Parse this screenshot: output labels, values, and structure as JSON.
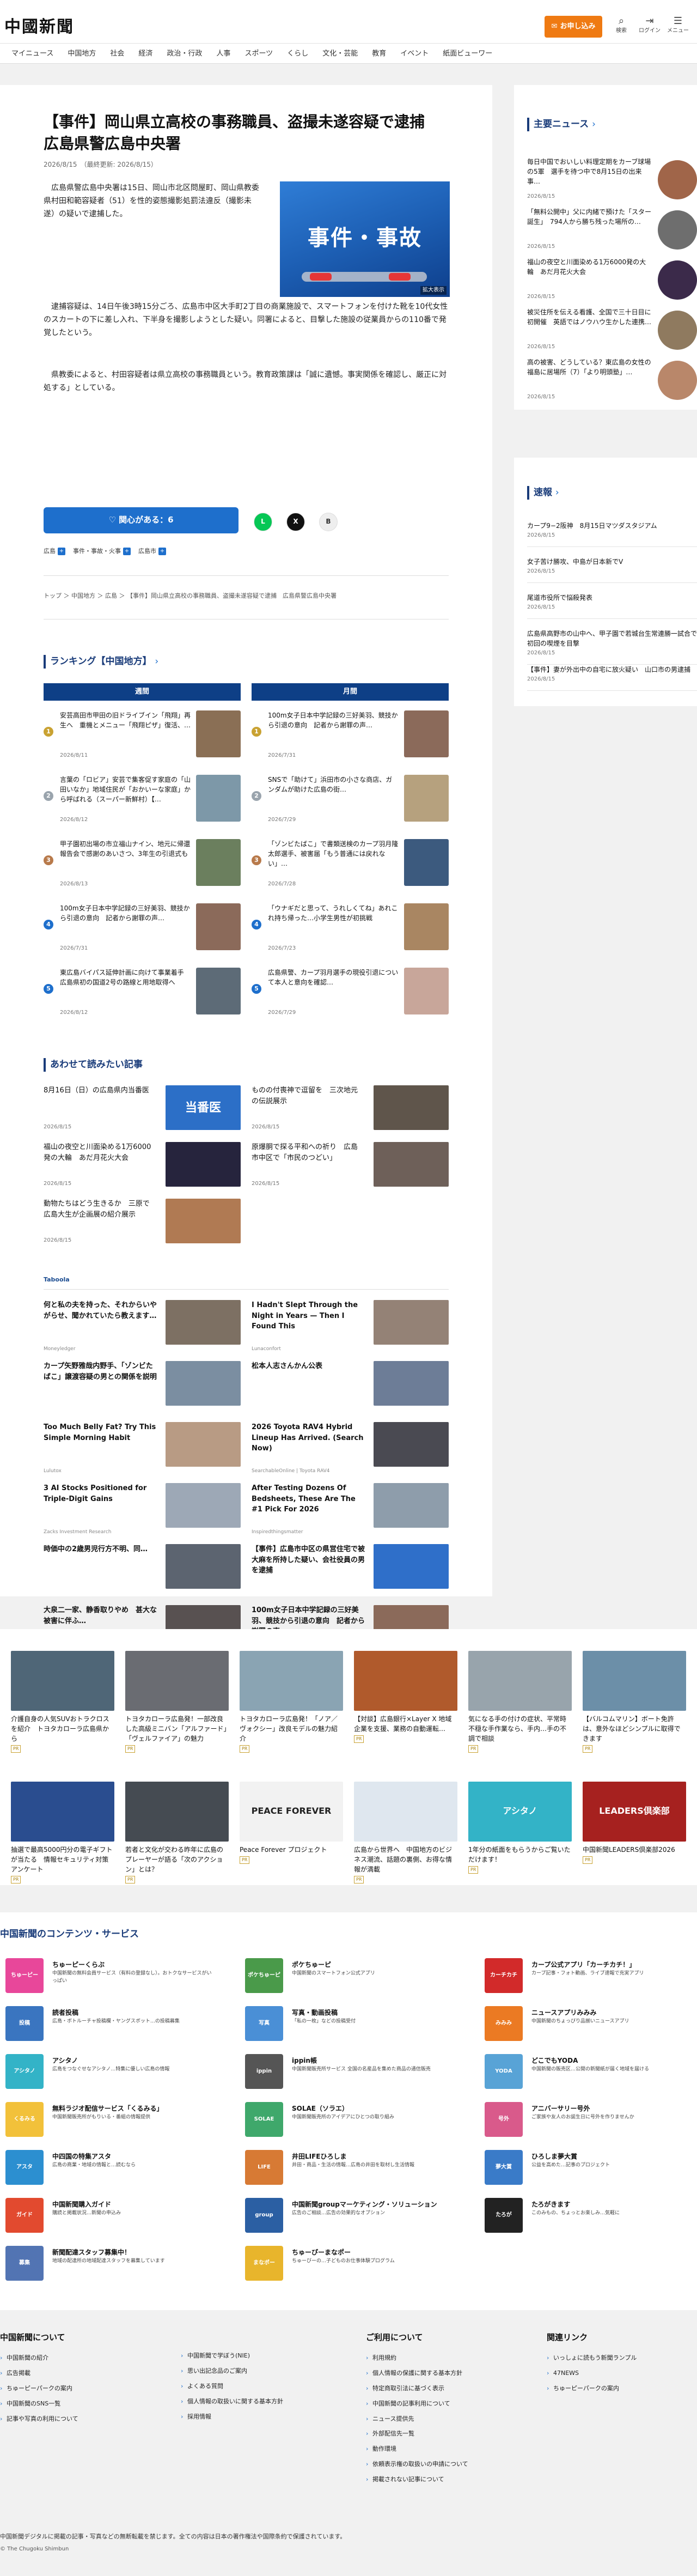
{
  "header": {
    "logo": "中國新聞",
    "subscribe": "お申し込み",
    "icons": [
      {
        "name": "search-icon",
        "glyph": "⌕",
        "label": "検索"
      },
      {
        "name": "login-icon",
        "glyph": "⇥",
        "label": "ログイン"
      },
      {
        "name": "menu-icon",
        "glyph": "☰",
        "label": "メニュー"
      }
    ]
  },
  "nav": [
    "マイニュース",
    "中国地方",
    "社会",
    "経済",
    "政治・行政",
    "人事",
    "スポーツ",
    "くらし",
    "文化・芸能",
    "教育",
    "イベント",
    "紙面ビューワー"
  ],
  "article": {
    "title": "【事件】岡山県立高校の事務職員、盗撮未遂容疑で逮捕　広島県警広島中央署",
    "date": "2026/8/15　（最終更新: 2026/8/15）",
    "photo_text": "事件・事故",
    "photo_caption": "拡大表示",
    "p1": "　広島県警広島中央署は15日、岡山市北区問屋町、岡山県教委県村田和範容疑者（51）を性的姿態撮影処罰法違反（撮影未遂）の疑いで逮捕した。",
    "p2": "　逮捕容疑は、14日午後3時15分ごろ、広島市中区大手町2丁目の商業施設で、スマートフォンを付けた靴を10代女性のスカートの下に差し入れ、下半身を撮影しようとした疑い。同署によると、目撃した施設の従業員からの110番で発覚したという。",
    "p3": "　県教委によると、村田容疑者は県立高校の事務職員という。教育政策課は「誠に遺憾。事実関係を確認し、厳正に対処する」としている。",
    "like": "関心がある：6",
    "share": [
      {
        "name": "line-share-icon",
        "glyph": "L",
        "bg": "#06c755",
        "fg": "#fff"
      },
      {
        "name": "x-share-icon",
        "glyph": "X",
        "bg": "#111",
        "fg": "#fff"
      },
      {
        "name": "bookmark-icon",
        "glyph": "B",
        "bg": "#eee",
        "fg": "#333"
      }
    ],
    "tags": [
      "広島",
      "事件・事故・火事",
      "広島市"
    ],
    "breadcrumb": "トップ ＞ 中国地方 ＞ 広島 ＞ 【事件】岡山県立高校の事務職員、盗撮未遂容疑で逮捕　広島県警広島中央署"
  },
  "ranking": {
    "title": "ランキング【中国地方】",
    "weekly_label": "週間",
    "monthly_label": "月間",
    "weekly": [
      {
        "n": "1",
        "text": "安芸高田市甲田の旧ドライブイン「飛翔」再生へ　重機とメニュー「飛翔ピザ」復活、…",
        "meta": "2026/8/11",
        "color": "#c9a232",
        "thumb": "#8a6f55"
      },
      {
        "n": "2",
        "text": "言葉の「ロビア」安芸で集客促す家庭の「山田いなか」地域住民が「おかいーな家庭」から呼ばれる（スーパー新鮮村）【…",
        "meta": "2026/8/12",
        "color": "#9aa4ad",
        "thumb": "#7d98a8"
      },
      {
        "n": "3",
        "text": "甲子園初出場の市立福山ナイン、地元に帰還　報告会で感謝のあいさつ、3年生の引退式も",
        "meta": "2026/8/13",
        "color": "#b87a4b",
        "thumb": "#6b7f5e"
      },
      {
        "n": "4",
        "text": "100m女子日本中学記録の三好美羽、競技から引退の意向　記者から謝罪の声…",
        "meta": "2026/7/31",
        "color": "#1e6fcc",
        "thumb": "#8b6a5a"
      },
      {
        "n": "5",
        "text": "東広島バイパス延伸計画に向けて事業着手　広島県初の国道2号の路線と用地取得へ",
        "meta": "2026/8/12",
        "color": "#1e6fcc",
        "thumb": "#5d6b77"
      }
    ],
    "monthly": [
      {
        "n": "1",
        "text": "100m女子日本中学記録の三好美羽、競技から引退の意向　記者から謝罪の声…",
        "meta": "2026/7/31",
        "color": "#c9a232",
        "thumb": "#8b6a5a"
      },
      {
        "n": "2",
        "text": "SNSで「助けて」浜田市の小さな商店、ガンダムが助けた広島の街…",
        "meta": "2026/7/29",
        "color": "#9aa4ad",
        "thumb": "#b6a17e"
      },
      {
        "n": "3",
        "text": "「ゾンビたばこ」で書類送検のカープ羽月隆太郎選手、被害届「もう普通には戻れない」…",
        "meta": "2026/7/28",
        "color": "#b87a4b",
        "thumb": "#3c5a7e"
      },
      {
        "n": "4",
        "text": "「ウナギだと思って、うれしくてね」あれこれ持ち帰った…小学生男性が初挑戦",
        "meta": "2026/7/23",
        "color": "#1e6fcc",
        "thumb": "#a98662"
      },
      {
        "n": "5",
        "text": "広島県警、カープ羽月選手の現役引退について本人と意向を確認…",
        "meta": "2026/7/29",
        "color": "#1e6fcc",
        "thumb": "#c8a69a"
      }
    ]
  },
  "related": {
    "title": "あわせて読みたい記事",
    "items": [
      {
        "text": "8月16日（日）の広島県内当番医",
        "meta": "2026/8/15",
        "thumb": "#2c6fc7",
        "tlabel": "当番医"
      },
      {
        "text": "ものの付喪神で逗留を　三次地元の伝説展示",
        "meta": "2026/8/15",
        "thumb": "#5f554b",
        "tlabel": ""
      },
      {
        "text": "福山の夜空と川面染める1万6000発の大輪　あだ月花火大会",
        "meta": "2026/8/15",
        "thumb": "#26243d",
        "tlabel": ""
      },
      {
        "text": "原爆胴で探る平和への祈り　広島市中区で「市民のつどい」",
        "meta": "2026/8/15",
        "thumb": "#6e6059",
        "tlabel": ""
      },
      {
        "text": "動物たちはどう生きるか　三原で広島大生が企画展の紹介展示",
        "meta": "2026/8/15",
        "thumb": "#b07a53",
        "tlabel": ""
      }
    ]
  },
  "taboola": {
    "brand": "Taboola",
    "items": [
      {
        "text": "何と私の夫を持った、それからいやがらせ、聞かれていたら教えます…",
        "src": "Moneyledger",
        "thumb": "#7d7063"
      },
      {
        "text": "I Hadn't Slept Through the Night in Years — Then I Found This",
        "src": "Lunaconfort",
        "thumb": "#948276"
      },
      {
        "text": "カープ矢野雅哉内野手、「ゾンビたばこ」譲渡容疑の男との関係を説明",
        "src": "",
        "thumb": "#7b8ea1"
      },
      {
        "text": "松本人志さんかん公表",
        "src": "",
        "thumb": "#6d7d97"
      },
      {
        "text": "Too Much Belly Fat? Try This Simple Morning Habit",
        "src": "Lulutox",
        "thumb": "#b89b84"
      },
      {
        "text": "2026 Toyota RAV4 Hybrid Lineup Has Arrived. (Search Now)",
        "src": "SearchableOnline | Toyota RAV4",
        "thumb": "#4a4a52"
      },
      {
        "text": "3 AI Stocks Positioned for Triple-Digit Gains",
        "src": "Zacks Investment Research",
        "thumb": "#9da8b6"
      },
      {
        "text": "After Testing Dozens Of Bedsheets, These Are The #1 Pick For 2026",
        "src": "Inspiredthingsmatter",
        "thumb": "#8e9dab"
      },
      {
        "text": "時価中の2歳男児行方不明、同…",
        "src": "",
        "thumb": "#5c6470"
      },
      {
        "text": "【事件】広島市中区の県営住宅で被大麻を所持した疑い、会社役員の男を逮捕",
        "src": "",
        "thumb": "#2f6fc9"
      },
      {
        "text": "大泉二一家、静香取りやめ　甚大な被害に伴ふ…",
        "src": "",
        "thumb": "#585151"
      },
      {
        "text": "100m女子日本中学記録の三好美羽、競技から引退の意向　記者から謝罪の声…",
        "src": "",
        "thumb": "#8b6a5a"
      }
    ]
  },
  "sidebar": {
    "main_title": "主要ニュース",
    "main": [
      {
        "text": "毎日中国でおいしい料理定期をカーブ球場の5軍　選手を待つ中で8月15日の出来事…",
        "meta": "2026/8/15",
        "thumb": "#a06549"
      },
      {
        "text": "「無料公開中」父に内緒で預けた「スター誕生」　794人から勝ち残った場所の…",
        "meta": "2026/8/15",
        "thumb": "#6e6e6e"
      },
      {
        "text": "福山の夜空と川面染める1万6000発の大輪　あだ月花火大会",
        "meta": "2026/8/15",
        "thumb": "#3b2a4a"
      },
      {
        "text": "被災住所を伝える看護、全国で三十日目に初開催　英語ではノウハウ生かした連携…",
        "meta": "2026/8/15",
        "thumb": "#8f7a5f"
      },
      {
        "text": "高の被害、どうしている？東広島の女性の福島に居場所（7）「より明頭塾」…",
        "meta": "2026/8/15",
        "thumb": "#b9876a"
      }
    ],
    "break_title": "速報",
    "breaking": [
      {
        "text": "カープ9−2阪神　8月15日マツダスタジアム",
        "meta": "2026/8/15"
      },
      {
        "text": "女子苦け勝攻、中島が日本新でV",
        "meta": "2026/8/15"
      },
      {
        "text": "尾道市役所で悩殺発表",
        "meta": "2026/8/15"
      },
      {
        "text": "広島県高野市の山中へ、甲子園で若城台生常連勝一試合で初回の喫煙を目撃",
        "meta": "2026/8/15"
      },
      {
        "text": "【事件】妻が外出中の自宅に放火疑い　山口市の男逮捕",
        "meta": "2026/8/15"
      }
    ]
  },
  "ads": [
    {
      "text": "介護自身の人気SUVおトラクロスを紹介　トヨタカローラ広島県から",
      "thumb": "#4f6677"
    },
    {
      "text": "トヨタカローラ広島発！一部改良した高級ミニバン「アルファード」「ヴェルファイア」の魅力",
      "thumb": "#6a6c72"
    },
    {
      "text": "トヨタカローラ広島発！「ノア／ヴォクシー」改良モデルの魅力紹介",
      "thumb": "#8aa4b3"
    },
    {
      "text": "【対談】広島銀行×Layer X 地域企業を支援、業務の自動運転…",
      "thumb": "#b05a2c"
    },
    {
      "text": "気になる手の付けの症状、平常時不穏な手作業なら、手内…手の不調で相談",
      "thumb": "#98a4ac"
    },
    {
      "text": "【バルコムマリン】ボート免許は、意外なほどシンプルに取得できます",
      "thumb": "#6c8fa8"
    },
    {
      "text": "抽選で最高5000円分の電子ギフトが当たる　情報セキュリティ対策アンケート",
      "thumb": "#2a4d8f"
    },
    {
      "text": "若者と文化が交わる昨年に広島のプレーヤーが語る「次のアクション」とは？",
      "thumb": "#454b52"
    },
    {
      "text": "Peace Forever プロジェクト",
      "thumb": "#f2f2f2",
      "tlabel": "PEACE FOREVER"
    },
    {
      "text": "広島から世界へ　中国地方のビジネス潮流、話題の裏側、お得な情報が満載",
      "thumb": "#dfe7ef"
    },
    {
      "text": "1年分の紙面をもらうからご覧いただけます！",
      "thumb": "#33b3c7",
      "tlabel": "アシタノ"
    },
    {
      "text": "中国新聞LEADERS倶楽部2026",
      "thumb": "#a6211f",
      "tlabel": "LEADERS倶楽部"
    }
  ],
  "services": {
    "title": "中国新聞のコンテンツ・サービス",
    "items": [
      {
        "nm": "ちゅーピーくらぶ",
        "ds": "中国新聞の無料会員サービス（有料の登録なし）。おトクなサービスがいっぱい",
        "c": "#e8479a",
        "ic": "ちゅーピー"
      },
      {
        "nm": "ポケちゅーピ",
        "ds": "中国新聞のスマートフォン公式アプリ",
        "c": "#4a9a4a",
        "ic": "ポケちゅーピ"
      },
      {
        "nm": "カープ公式アプリ「カーチカチ！」",
        "ds": "カープ記事・フォト動画、ライブ速報で充実アプリ",
        "c": "#d22a2a",
        "ic": "カーチカチ"
      },
      {
        "nm": "読者投稿",
        "ds": "広島・ボトルーチャ投稿欄・ヤングスボット…の投稿募集",
        "c": "#3a75c0",
        "ic": "投稿"
      },
      {
        "nm": "写真・動画投稿",
        "ds": "「私の一枚」などの投稿受付",
        "c": "#4a8fd6",
        "ic": "写真"
      },
      {
        "nm": "ニュースアプリみみみ",
        "ds": "中国新聞のちょっぴり品揃いニュースアプリ",
        "c": "#eb7a23",
        "ic": "みみみ"
      },
      {
        "nm": "アシタノ",
        "ds": "広島をつなぐせなアシタノ…特集に優しい広島の情報",
        "c": "#33b3c7",
        "ic": "アシタノ"
      },
      {
        "nm": "ippin帳",
        "ds": "中国新聞販売所サービス 全国の名産品を集めた商品の通信販売",
        "c": "#555",
        "ic": "ippin"
      },
      {
        "nm": "どこでもYODA",
        "ds": "中国新聞の販売区…公開の新聞紙が届く地域を届ける",
        "c": "#58a3d6",
        "ic": "YODA"
      },
      {
        "nm": "無料ラジオ配信サービス「くるみる」",
        "ds": "中国新聞販売所がもりいる・番組の情報提供",
        "c": "#f2c13a",
        "ic": "くるみる"
      },
      {
        "nm": "SOLAE（ソラエ）",
        "ds": "中国新聞販売所のアイデアにひとつの取り組み",
        "c": "#3fa86b",
        "ic": "SOLAE"
      },
      {
        "nm": "アニバーサリー号外",
        "ds": "ご家族や友人のお誕生日に号外を作りませんか",
        "c": "#d95a8b",
        "ic": "号外"
      },
      {
        "nm": "中四国の特集アスタ",
        "ds": "広島の商業・地域の情報と…読むなら",
        "c": "#2c8fd0",
        "ic": "アスタ"
      },
      {
        "nm": "井田LIFEひろしま",
        "ds": "井田・商品・生活の情報…広島の井田を取材し生活情報",
        "c": "#d77a34",
        "ic": "LIFE"
      },
      {
        "nm": "ひろしま夢大賞",
        "ds": "公益を高めた…記事のプロジェクト",
        "c": "#3a7bc8",
        "ic": "夢大賞"
      },
      {
        "nm": "中国新聞購入ガイド",
        "ds": "購読と掲載状況…新聞の申込み",
        "c": "#e24a2f",
        "ic": "ガイド"
      },
      {
        "nm": "中国新聞groupマーケティング・ソリューション",
        "ds": "広告のご相談…広告の効果的なオプション",
        "c": "#2b5fa3",
        "ic": "group"
      },
      {
        "nm": "たろがきます",
        "ds": "このみもの、ちょっとお楽しみ…気軽に",
        "c": "#222",
        "ic": "たろが"
      },
      {
        "nm": "新聞配達スタッフ募集中！",
        "ds": "地域の配達所の地域配達スタッフを募集しています",
        "c": "#5274b3",
        "ic": "募集"
      },
      {
        "nm": "ちゅーぴーまなポー",
        "ds": "ちゅーびーの…子どものお仕事体験プログラム",
        "c": "#e8b52c",
        "ic": "まなポー"
      }
    ]
  },
  "footer": {
    "col1_title": "中国新聞について",
    "col1": [
      "中国新聞の紹介",
      "広告掲載",
      "ちゅーピーパークの案内",
      "中国新聞のSNS一覧",
      "記事や写真の利用について"
    ],
    "col1b": [
      "中国新聞で学ぼう(NIE)",
      "思い出記念品のご案内",
      "よくある質問",
      "個人情報の取扱いに関する基本方針",
      "採用情報"
    ],
    "col2_title": "ご利用について",
    "col2": [
      "利用規約",
      "個人情報の保護に関する基本方針",
      "特定商取引法に基づく表示",
      "中国新聞の記事利用について",
      "ニュース提供先",
      "外部配信先一覧",
      "動作環境",
      "依頼表示権の取扱いの申請について",
      "掲載されない記事について"
    ],
    "col3_title": "関連リンク",
    "col3": [
      "いっしょに読もう新聞ランプル",
      "47NEWS",
      "ちゅーピーパークの案内"
    ],
    "note": "中国新聞デジタルに掲載の記事・写真などの無断転載を禁じます。全ての内容は日本の著作権法や国際条約で保護されています。",
    "copyright": "© The Chugoku Shimbun"
  }
}
